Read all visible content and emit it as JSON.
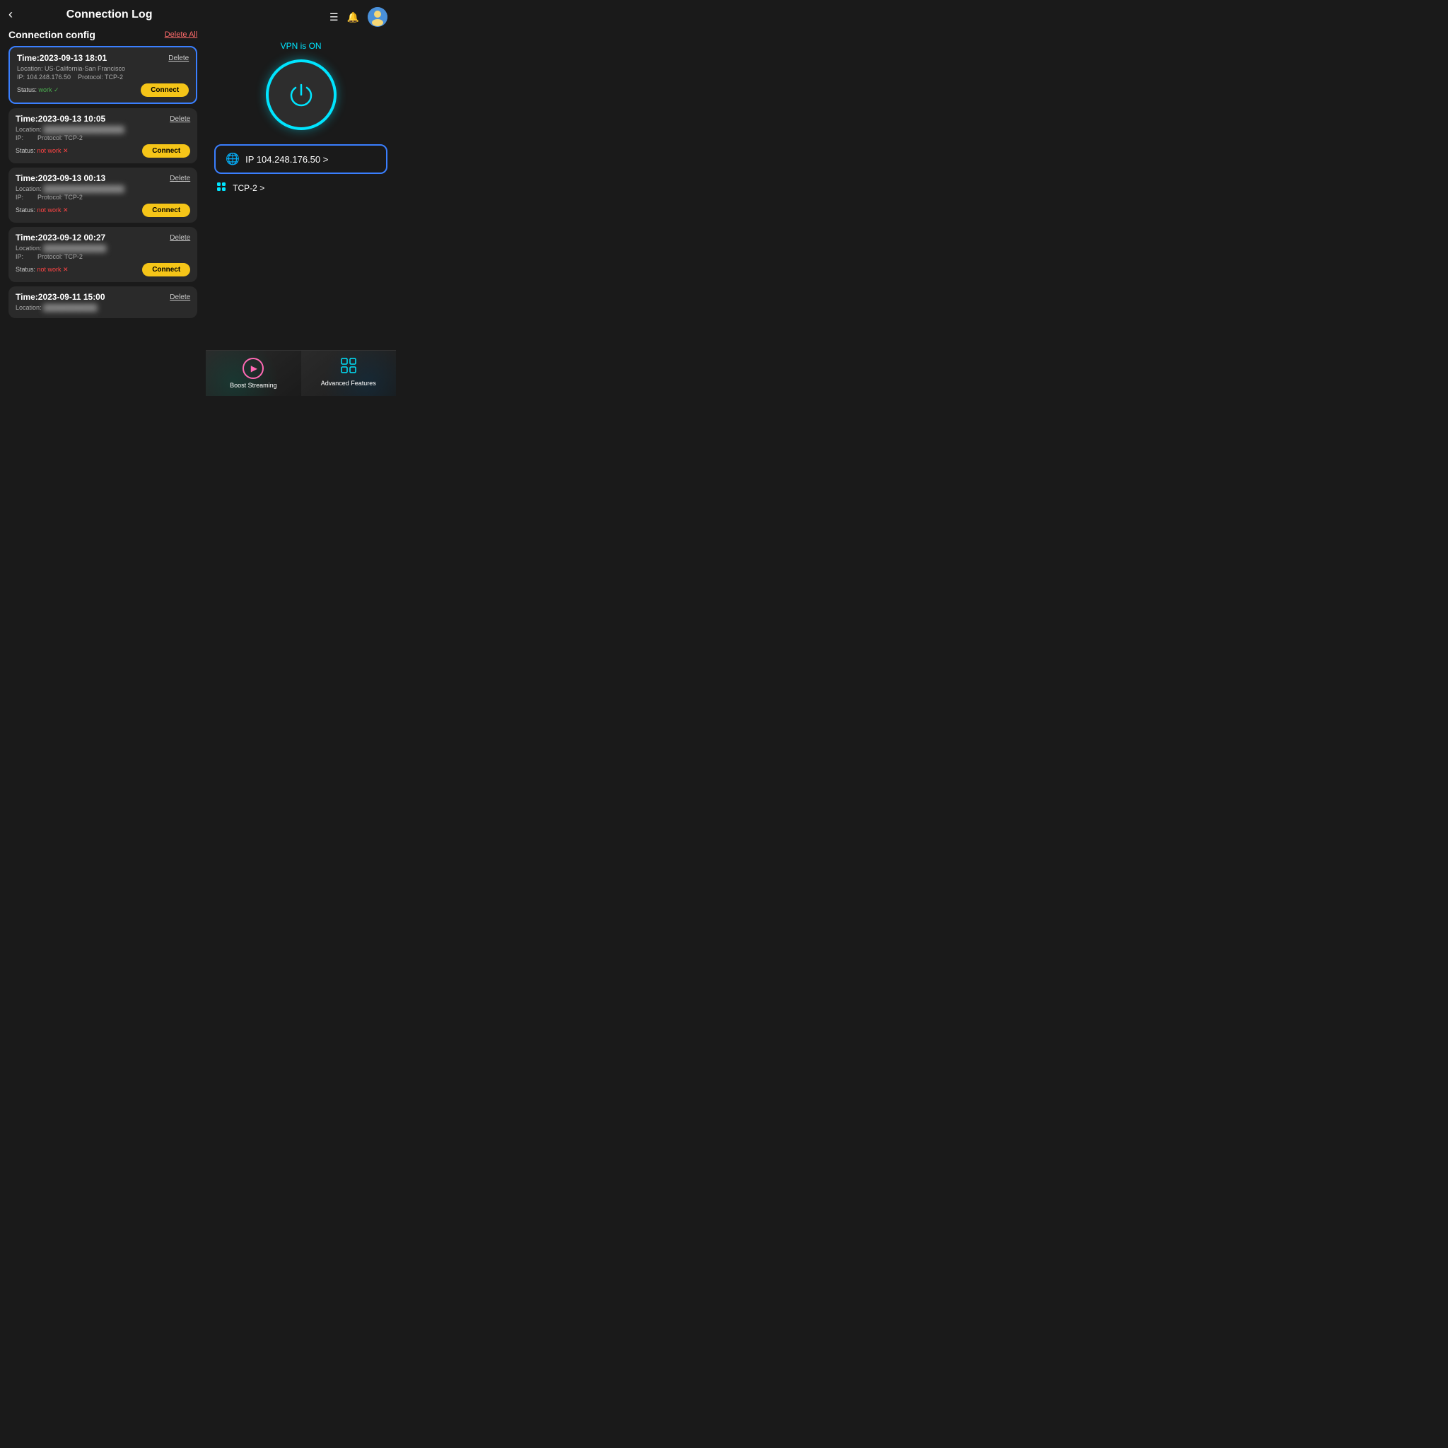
{
  "header": {
    "back_label": "‹",
    "title": "Connection Log",
    "menu_icon": "☰",
    "bell_icon": "🔔"
  },
  "left": {
    "config_title": "Connection config",
    "delete_all_label": "Delete All",
    "log_items": [
      {
        "time": "Time:2023-09-13 18:01",
        "delete_label": "Delete",
        "location": "Location: US-California-San Francisco",
        "ip": "IP: 104.248.176.50",
        "protocol": "Protocol: TCP-2",
        "status_label": "Status:",
        "status_value": "work",
        "status_type": "work",
        "connect_label": "Connect",
        "active": true,
        "blurred_location": false,
        "blurred_ip": false
      },
      {
        "time": "Time:2023-09-13 10:05",
        "delete_label": "Delete",
        "location": "Location:",
        "ip": "IP:",
        "protocol": "Protocol: TCP-2",
        "status_label": "Status:",
        "status_value": "not work",
        "status_type": "not-work",
        "connect_label": "Connect",
        "active": false,
        "blurred_location": true,
        "blurred_ip": true
      },
      {
        "time": "Time:2023-09-13 00:13",
        "delete_label": "Delete",
        "location": "Location:",
        "ip": "IP:",
        "protocol": "Protocol: TCP-2",
        "status_label": "Status:",
        "status_value": "not work",
        "status_type": "not-work",
        "connect_label": "Connect",
        "active": false,
        "blurred_location": true,
        "blurred_ip": true
      },
      {
        "time": "Time:2023-09-12 00:27",
        "delete_label": "Delete",
        "location": "Location:",
        "ip": "IP:",
        "protocol": "Protocol: TCP-2",
        "status_label": "Status:",
        "status_value": "not work",
        "status_type": "not-work",
        "connect_label": "Connect",
        "active": false,
        "blurred_location": true,
        "blurred_ip": true
      },
      {
        "time": "Time:2023-09-11 15:00",
        "delete_label": "Delete",
        "location": "Location:",
        "ip": "",
        "protocol": "",
        "status_label": "",
        "status_value": "",
        "status_type": "",
        "connect_label": "",
        "active": false,
        "blurred_location": true,
        "blurred_ip": false
      }
    ]
  },
  "right": {
    "vpn_status": "VPN is ON",
    "ip_display": "IP 104.248.176.50 >",
    "protocol_display": "TCP-2 >",
    "bottom_nav": [
      {
        "label": "Boost Streaming",
        "icon_type": "play-circle"
      },
      {
        "label": "Advanced Features",
        "icon_type": "grid"
      }
    ]
  }
}
